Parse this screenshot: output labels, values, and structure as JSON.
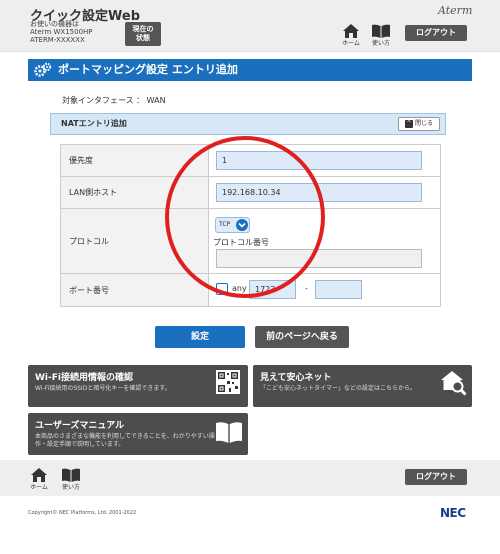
{
  "header": {
    "app_title": "クイック設定Web",
    "device_caption": "お使いの機器は",
    "model_name": "Aterm WX1500HP",
    "device_id": "ATERM-XXXXXX",
    "status_button_line1": "現在の",
    "status_button_line2": "状態",
    "brand": "Aterm",
    "home_label": "ホーム",
    "manual_label": "使い方",
    "logout_label": "ログアウト"
  },
  "page": {
    "title": "ポートマッピング設定 エントリ追加",
    "interface_text": "対象インタフェース ： WAN"
  },
  "nat_section": {
    "title": "NATエントリ追加",
    "close_label": "閉じる",
    "rows": {
      "priority": {
        "label": "優先度",
        "value": "1"
      },
      "lan_host": {
        "label": "LAN側ホスト",
        "value": "192.168.10.34"
      },
      "protocol": {
        "label": "プロトコル",
        "selected": "TCP",
        "number_label": "プロトコル番号",
        "number_value": ""
      },
      "port": {
        "label": "ポート番号",
        "any_label": "any",
        "port_from": "1723",
        "separator": "-",
        "port_to": ""
      }
    }
  },
  "actions": {
    "submit_label": "設定",
    "back_label": "前のページへ戻る"
  },
  "tiles": {
    "wifi": {
      "title": "Wi-Fi接続用情報の確認",
      "desc": "Wi-Fi接続用のSSIDと暗号化キーを確認できます。"
    },
    "safety": {
      "title": "見えて安心ネット",
      "desc": "「こども安心ネットタイマー」などの設定はこちらから。"
    },
    "manual": {
      "title": "ユーザーズマニュアル",
      "desc1": "本商品のさまざまな機能を利用してできることを、わかりやすい操",
      "desc2": "作・設定手順で説明しています。"
    }
  },
  "footer": {
    "home_label": "ホーム",
    "manual_label": "使い方",
    "logout_label": "ログアウト",
    "copyright": "Copyright© NEC Platforms, Ltd. 2001-2022",
    "company_logo": "NEC"
  },
  "colors": {
    "primary_blue": "#1a6fbe",
    "dark_button": "#555555",
    "annotation_red": "#e02020"
  }
}
